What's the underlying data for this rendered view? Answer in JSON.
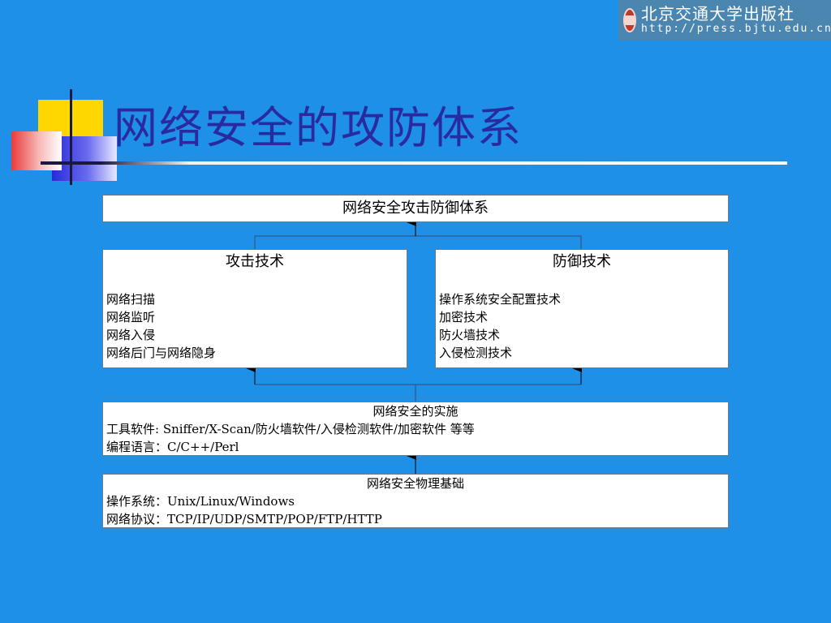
{
  "publisher": {
    "name": "北京交通大学出版社",
    "url": "http://press.bjtu.edu.cn"
  },
  "slide": {
    "title": "网络安全的攻防体系"
  },
  "diagram": {
    "top_box": {
      "label": "网络安全攻击防御体系"
    },
    "attack_box": {
      "heading": "攻击技术",
      "items": [
        "网络扫描",
        "网络监听",
        "网络入侵",
        "网络后门与网络隐身"
      ]
    },
    "defense_box": {
      "heading": "防御技术",
      "items": [
        "操作系统安全配置技术",
        "加密技术",
        "防火墙技术",
        "入侵检测技术"
      ]
    },
    "implementation_box": {
      "heading": "网络安全的实施",
      "lines": [
        "工具软件: Sniffer/X-Scan/防火墙软件/入侵检测软件/加密软件 等等",
        "编程语言：C/C++/Perl"
      ]
    },
    "physical_box": {
      "heading": "网络安全物理基础",
      "lines": [
        "操作系统：Unix/Linux/Windows",
        "网络协议：TCP/IP/UDP/SMTP/POP/FTP/HTTP"
      ]
    }
  },
  "colors": {
    "background": "#1E90E8",
    "title": "#2A2AA0",
    "connector": "#3A4A6A"
  }
}
